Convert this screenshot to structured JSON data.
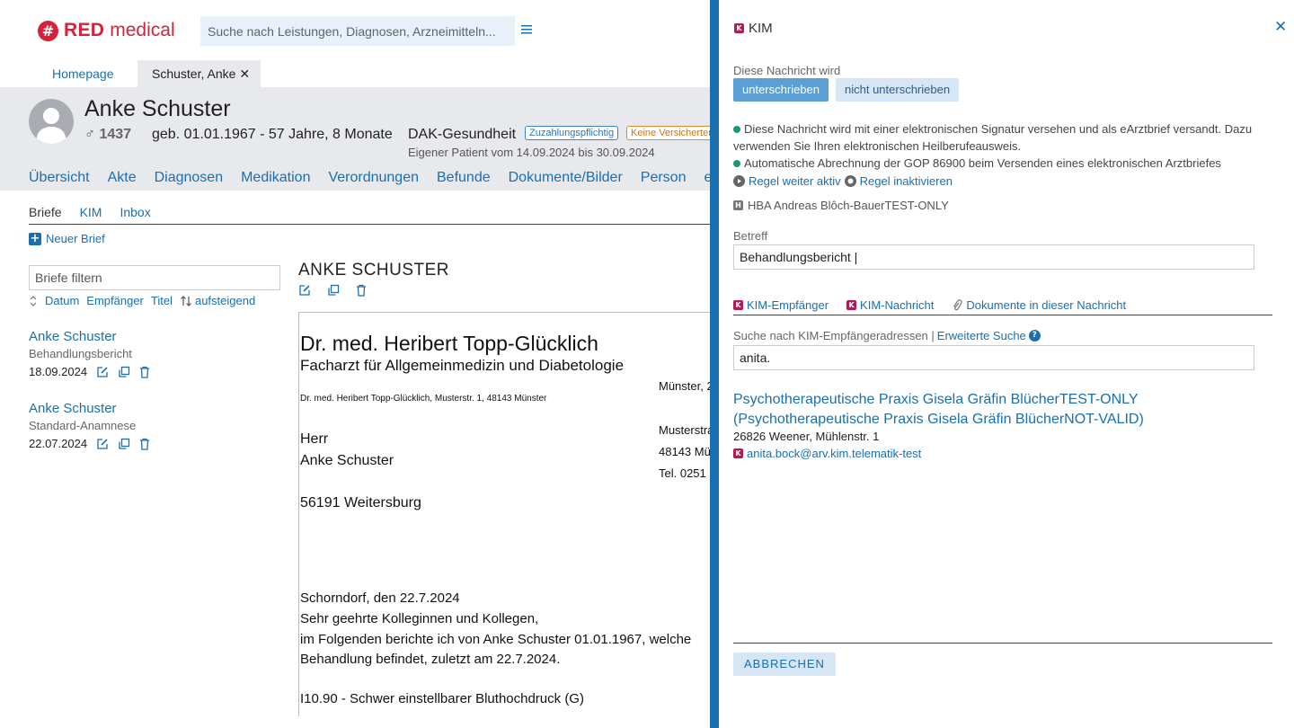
{
  "header": {
    "brand_mark": "#",
    "brand_red": "RED",
    "brand_medical": "medical",
    "search_placeholder": "Suche nach Leistungen, Diagnosen, Arzneimitteln..."
  },
  "tabs": {
    "home": "Homepage",
    "patient": "Schuster, Anke",
    "close": "✕"
  },
  "patient": {
    "name": "Anke Schuster",
    "gender_symbol": "♂",
    "id": "1437",
    "dob": "geb. 01.01.1967 - 57 Jahre, 8 Monate",
    "insurance": "DAK-Gesundheit",
    "badge_copay": "Zuzahlungspflichtig",
    "badge_insured": "Keine Versicherten",
    "own_patient": "Eigener Patient vom 14.09.2024 bis 30.09.2024",
    "nav": [
      "Übersicht",
      "Akte",
      "Diagnosen",
      "Medikation",
      "Verordnungen",
      "Befunde",
      "Dokumente/Bilder",
      "Person",
      "e"
    ]
  },
  "subtabs": [
    "Briefe",
    "KIM",
    "Inbox"
  ],
  "new_letter": "Neuer Brief",
  "filter_placeholder": "Briefe filtern",
  "sort": {
    "date": "Datum",
    "recipient": "Empfänger",
    "title": "Titel",
    "order": "aufsteigend"
  },
  "letters": [
    {
      "title": "Anke Schuster",
      "subtitle": "Behandlungsbericht",
      "date": "18.09.2024"
    },
    {
      "title": "Anke Schuster",
      "subtitle": "Standard-Anamnese",
      "date": "22.07.2024"
    }
  ],
  "document": {
    "heading": "ANKE SCHUSTER",
    "doctor": "Dr. med. Heribert Topp-Glücklich",
    "specialty": "Facharzt für Allgemeinmedizin und Diabetologie",
    "city_right": "Münster, 2",
    "sender_line": "Dr. med. Heribert Topp-Glücklich, Musterstr. 1, 48143 Münster",
    "street_right": "Musterstra",
    "zip_right": "48143 Mü",
    "tel_right": "Tel. 0251",
    "salutation": "Herr",
    "recipient": "Anke Schuster",
    "recipient_city": "56191 Weitersburg",
    "place_date": "Schorndorf, den 22.7.2024",
    "greeting": "Sehr geehrte Kolleginnen und Kollegen,",
    "body1": "im Folgenden berichte ich von Anke Schuster 01.01.1967, welche",
    "body2": "Behandlung befindet, zuletzt am 22.7.2024.",
    "diagnosis": "I10.90 - Schwer einstellbarer Bluthochdruck (G)"
  },
  "panel": {
    "title": "KIM",
    "close": "✕",
    "sign_label": "Diese Nachricht wird",
    "btn_sign": "unterschrieben",
    "btn_nosign": "nicht unterschrieben",
    "info1": "Diese Nachricht wird mit einer elektronischen Signatur versehen und als eArztbrief versandt. Dazu verwenden Sie Ihren elektronischen Heilberufeausweis.",
    "info2": "Automatische Abrechnung der GOP 86900 beim Versenden eines elektronischen Arztbriefes",
    "rule_active": "Regel weiter aktiv",
    "rule_deactivate": "Regel inaktivieren",
    "hba": "HBA Andreas Blôch-BauerTEST-ONLY",
    "subject_label": "Betreff",
    "subject_value": "Behandlungsbericht |",
    "tab_recipients": "KIM-Empfänger",
    "tab_message": "KIM-Nachricht",
    "tab_documents": "Dokumente in dieser Nachricht",
    "search_label": "Suche nach KIM-Empfängeradressen |",
    "advanced_search": "Erweiterte Suche",
    "search_value": "anita.",
    "result_line1": "Psychotherapeutische Praxis Gisela Gräfin BlücherTEST-ONLY",
    "result_line2": "(Psychotherapeutische Praxis Gisela Gräfin BlücherNOT-VALID)",
    "result_address": "26826 Weener, Mühlenstr. 1",
    "result_email": "anita.bock@arv.kim.telematik-test",
    "cancel": "ABBRECHEN"
  },
  "colors": {
    "brand_red": "#d6213a",
    "link_blue": "#1a6fb0",
    "divider_blue": "#1a6fb0",
    "kim_badge": "#b11a57",
    "status_green": "#1a9a6a"
  }
}
